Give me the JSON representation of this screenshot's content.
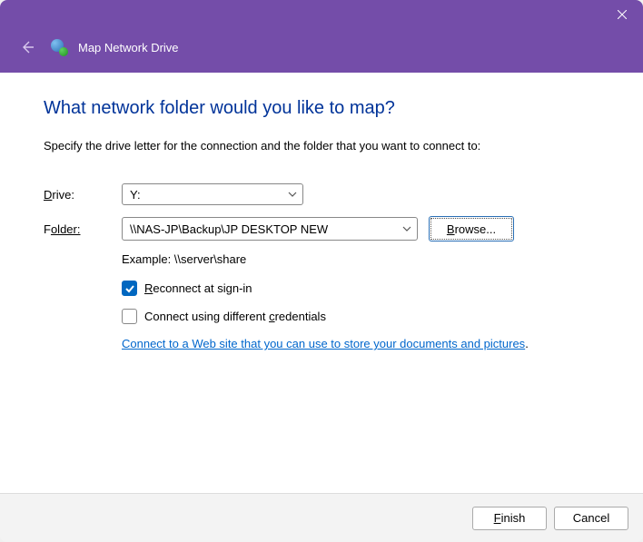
{
  "header": {
    "title": "Map Network Drive"
  },
  "main": {
    "heading": "What network folder would you like to map?",
    "instruction": "Specify the drive letter for the connection and the folder that you want to connect to:",
    "drive_label_pre": "D",
    "drive_label_post": "rive:",
    "drive_value": "Y:",
    "folder_label_pre": "F",
    "folder_label_post": "older:",
    "folder_value": "\\\\NAS-JP\\Backup\\JP DESKTOP NEW",
    "browse_pre": "B",
    "browse_post": "rowse...",
    "example": "Example: \\\\server\\share",
    "reconnect_pre": "R",
    "reconnect_post": "econnect at sign-in",
    "reconnect_checked": true,
    "credentials_pre": "Connect using different ",
    "credentials_u": "c",
    "credentials_post": "redentials",
    "credentials_checked": false,
    "link_text": "Connect to a Web site that you can use to store your documents and pictures",
    "link_period": "."
  },
  "footer": {
    "finish_pre": "F",
    "finish_post": "inish",
    "cancel": "Cancel"
  }
}
